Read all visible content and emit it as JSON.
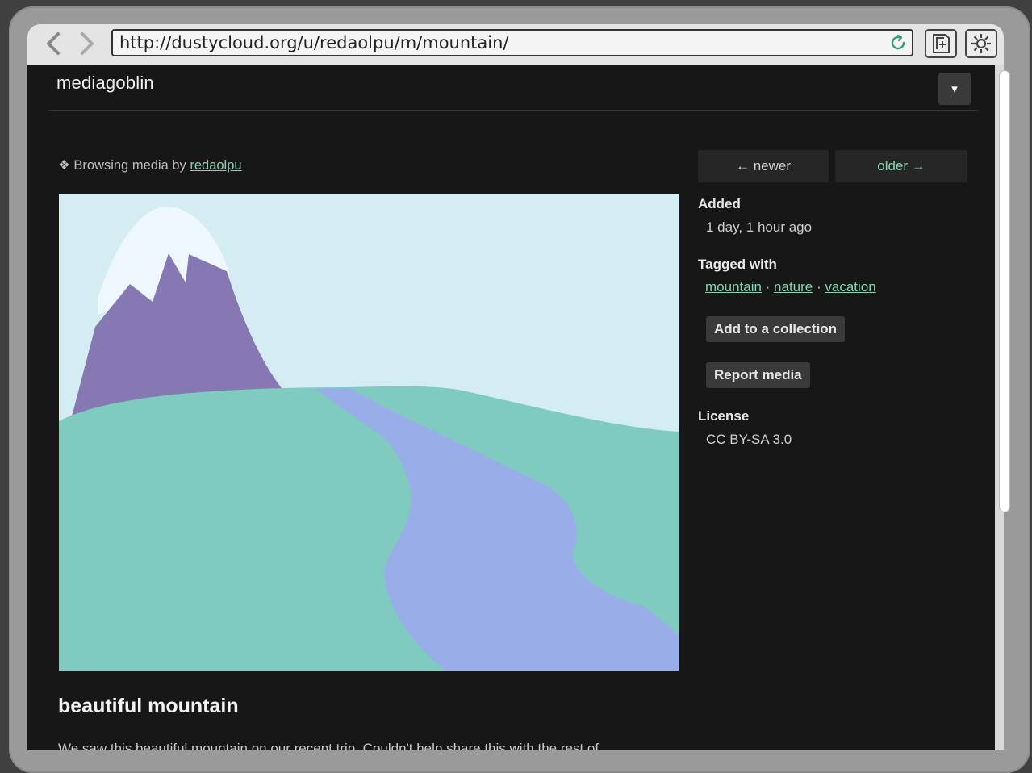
{
  "browser": {
    "url": "http://dustycloud.org/u/redaolpu/m/mountain/"
  },
  "site": {
    "name": "mediagoblin",
    "menu_toggle": "▾"
  },
  "breadcrumb": {
    "prefix": "❖ Browsing media by ",
    "user": "redaolpu"
  },
  "pager": {
    "newer": "← newer",
    "older": "older →"
  },
  "media": {
    "title": "beautiful mountain",
    "description": "We saw this beautiful mountain on our recent trip. Couldn't help share this with the rest of",
    "colors": {
      "sky": "#d4edf2",
      "snow": "#eef7ff",
      "mountain": "#8678b2",
      "hills": "#7fcbc0",
      "river": "#99aee8"
    }
  },
  "sidebar": {
    "added_label": "Added",
    "added_value": "1 day, 1 hour ago",
    "tagged_label": "Tagged with",
    "tags": [
      "mountain",
      "nature",
      "vacation"
    ],
    "tag_separator": " · ",
    "add_collection": "Add to a collection",
    "report": "Report media",
    "license_label": "License",
    "license_value": "CC BY-SA 3.0"
  },
  "colors": {
    "link": "#86d4b1",
    "page_bg": "#171717"
  }
}
